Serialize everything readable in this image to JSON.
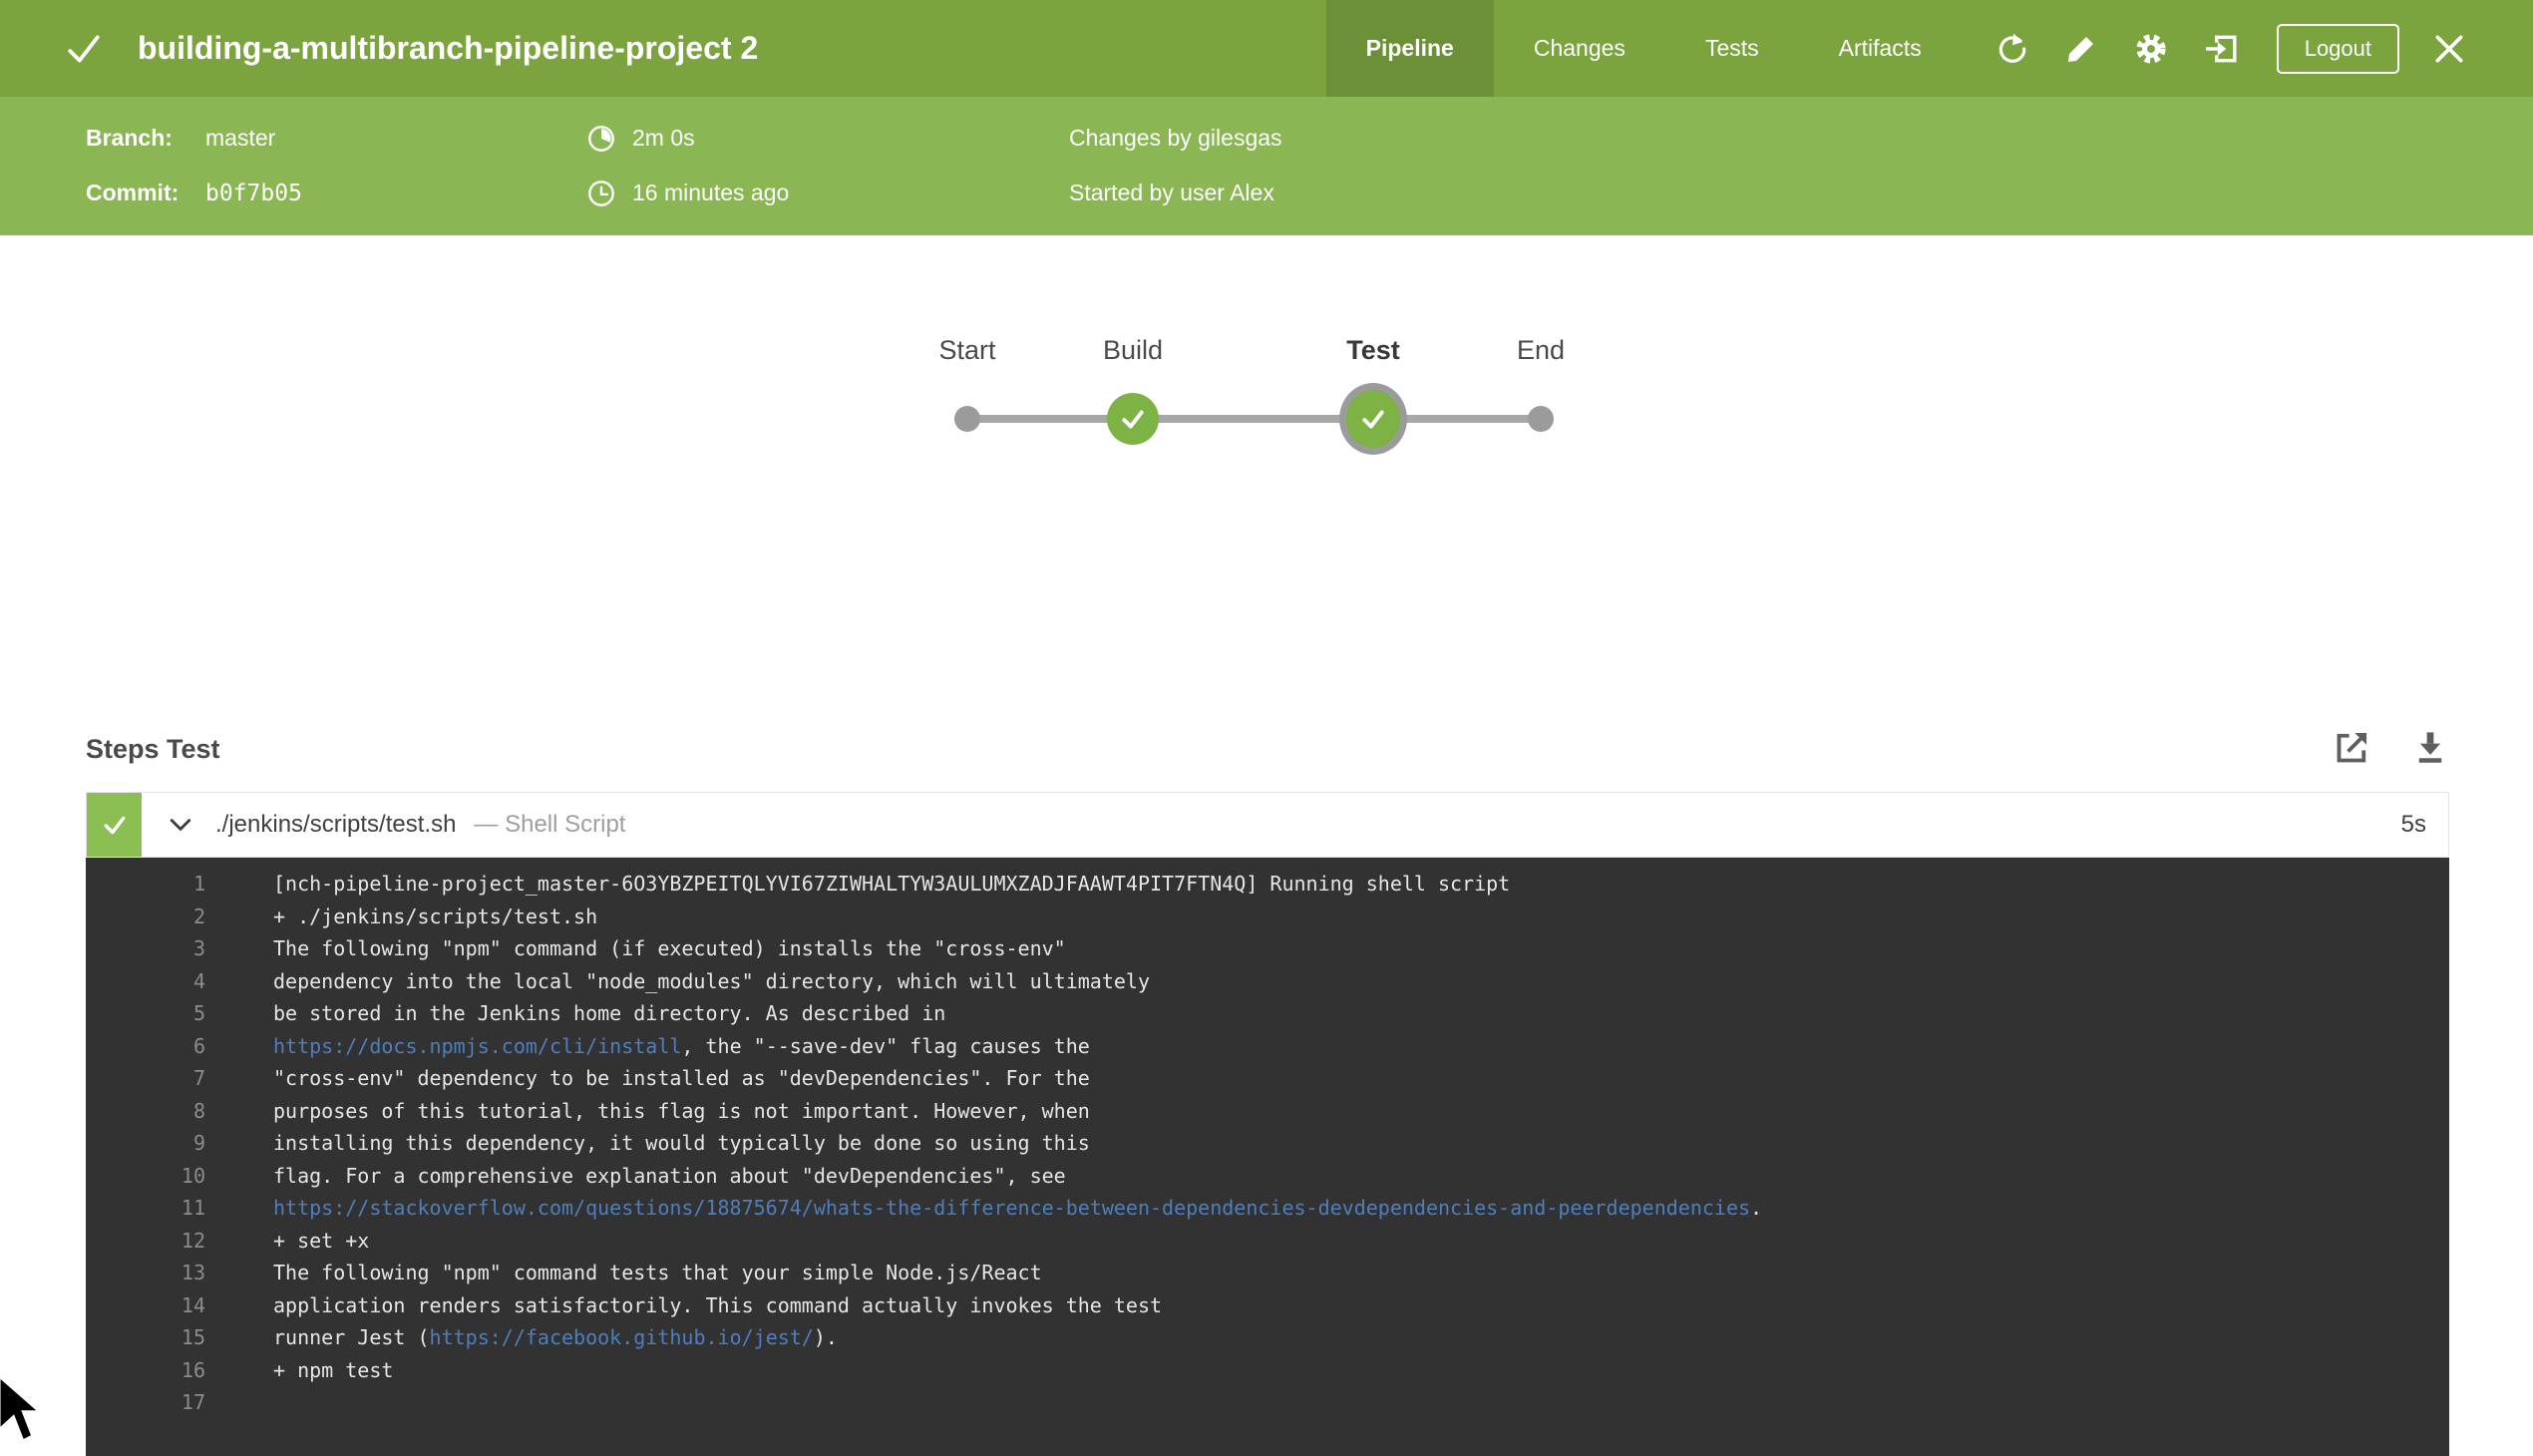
{
  "header": {
    "status_icon": "check-icon",
    "title": "building-a-multibranch-pipeline-project 2",
    "tabs": [
      {
        "label": "Pipeline",
        "active": true
      },
      {
        "label": "Changes",
        "active": false
      },
      {
        "label": "Tests",
        "active": false
      },
      {
        "label": "Artifacts",
        "active": false
      }
    ],
    "action_icons": [
      "rerun-icon",
      "edit-icon",
      "settings-icon",
      "go-to-classic-icon"
    ],
    "logout_label": "Logout",
    "close_icon": "close-icon"
  },
  "run_info": {
    "branch_label": "Branch:",
    "branch_value": "master",
    "commit_label": "Commit:",
    "commit_value": "b0f7b05",
    "duration": "2m 0s",
    "started_ago": "16 minutes ago",
    "changes_by": "Changes by gilesgas",
    "started_by": "Started by user Alex"
  },
  "graph": {
    "nodes": [
      {
        "label": "Start",
        "type": "terminal",
        "selected": false
      },
      {
        "label": "Build",
        "type": "success",
        "selected": false
      },
      {
        "label": "Test",
        "type": "success",
        "selected": true
      },
      {
        "label": "End",
        "type": "terminal",
        "selected": false
      }
    ]
  },
  "steps": {
    "heading": "Steps Test",
    "action_icons": [
      "open-in-new-icon",
      "download-icon"
    ],
    "step": {
      "status": "success",
      "title": "./jenkins/scripts/test.sh",
      "subtitle": "— Shell Script",
      "duration": "5s"
    }
  },
  "console": {
    "lines": [
      {
        "n": "1",
        "segments": [
          {
            "text": "[nch-pipeline-project_master-6O3YBZPEITQLYVI67ZIWHALTYW3AULUMXZADJFAAWT4PIT7FTN4Q] Running shell script"
          }
        ]
      },
      {
        "n": "2",
        "segments": [
          {
            "text": "+ ./jenkins/scripts/test.sh"
          }
        ]
      },
      {
        "n": "3",
        "segments": [
          {
            "text": "The following \"npm\" command (if executed) installs the \"cross-env\""
          }
        ]
      },
      {
        "n": "4",
        "segments": [
          {
            "text": "dependency into the local \"node_modules\" directory, which will ultimately"
          }
        ]
      },
      {
        "n": "5",
        "segments": [
          {
            "text": "be stored in the Jenkins home directory. As described in"
          }
        ]
      },
      {
        "n": "6",
        "segments": [
          {
            "text": "https://docs.npmjs.com/cli/install",
            "link": true
          },
          {
            "text": ", the \"--save-dev\" flag causes the"
          }
        ]
      },
      {
        "n": "7",
        "segments": [
          {
            "text": "\"cross-env\" dependency to be installed as \"devDependencies\". For the"
          }
        ]
      },
      {
        "n": "8",
        "segments": [
          {
            "text": "purposes of this tutorial, this flag is not important. However, when"
          }
        ]
      },
      {
        "n": "9",
        "segments": [
          {
            "text": "installing this dependency, it would typically be done so using this"
          }
        ]
      },
      {
        "n": "10",
        "segments": [
          {
            "text": "flag. For a comprehensive explanation about \"devDependencies\", see"
          }
        ]
      },
      {
        "n": "11",
        "segments": [
          {
            "text": "https://stackoverflow.com/questions/18875674/whats-the-difference-between-dependencies-devdependencies-and-peerdependencies",
            "link": true
          },
          {
            "text": "."
          }
        ]
      },
      {
        "n": "12",
        "segments": [
          {
            "text": "+ set +x"
          }
        ]
      },
      {
        "n": "13",
        "segments": [
          {
            "text": "The following \"npm\" command tests that your simple Node.js/React"
          }
        ]
      },
      {
        "n": "14",
        "segments": [
          {
            "text": "application renders satisfactorily. This command actually invokes the test"
          }
        ]
      },
      {
        "n": "15",
        "segments": [
          {
            "text": "runner Jest ("
          },
          {
            "text": "https://facebook.github.io/jest/",
            "link": true
          },
          {
            "text": ")."
          }
        ]
      },
      {
        "n": "16",
        "segments": [
          {
            "text": "+ npm test"
          }
        ]
      },
      {
        "n": "17",
        "segments": []
      }
    ]
  },
  "colors": {
    "header_green": "#7BA33E",
    "subheader_green": "#8AB653",
    "active_tab_green": "#6C9038",
    "node_green": "#7DB244",
    "step_check_green": "#8BBF53",
    "console_background": "#323232",
    "console_text": "#E6E6E6",
    "line_number_gray": "#8C8C8C",
    "link_blue": "#4D7FBE"
  }
}
